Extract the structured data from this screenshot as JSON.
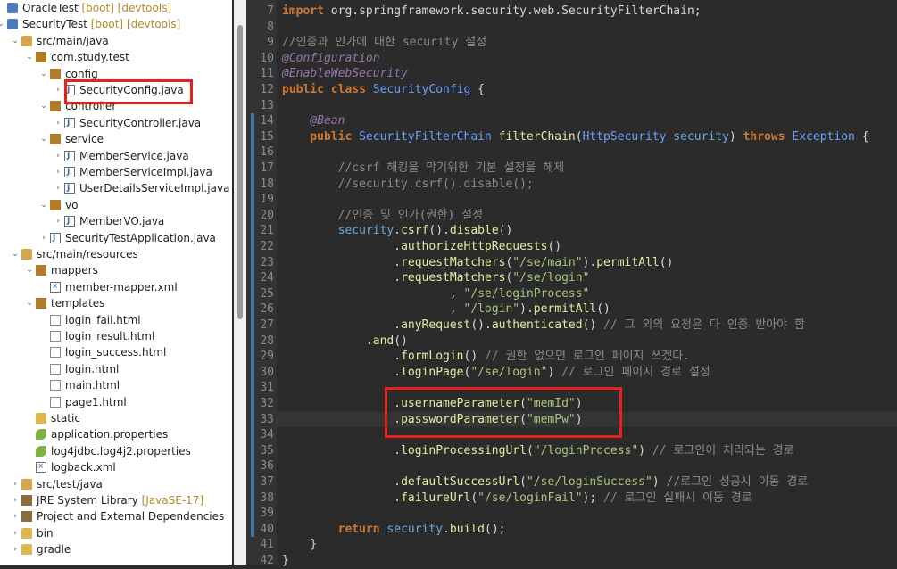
{
  "explorer": {
    "items": [
      {
        "label": "OracleTest",
        "dec": " [boot] [devtools]",
        "icon": "project-icon",
        "depth": 0,
        "arrow": ""
      },
      {
        "label": "SecurityTest",
        "dec": " [boot] [devtools]",
        "icon": "project-icon",
        "depth": 0,
        "arrow": "⌄"
      },
      {
        "label": "src/main/java",
        "dec": "",
        "icon": "source-folder-icon",
        "depth": 1,
        "arrow": "⌄"
      },
      {
        "label": "com.study.test",
        "dec": "",
        "icon": "package-icon",
        "depth": 2,
        "arrow": "⌄"
      },
      {
        "label": "config",
        "dec": "",
        "icon": "package-icon",
        "depth": 3,
        "arrow": "⌄"
      },
      {
        "label": "SecurityConfig.java",
        "dec": "",
        "icon": "java-file-icon",
        "depth": 4,
        "arrow": "›"
      },
      {
        "label": "controller",
        "dec": "",
        "icon": "package-icon",
        "depth": 3,
        "arrow": "⌄"
      },
      {
        "label": "SecurityController.java",
        "dec": "",
        "icon": "java-file-icon",
        "depth": 4,
        "arrow": "›"
      },
      {
        "label": "service",
        "dec": "",
        "icon": "package-icon",
        "depth": 3,
        "arrow": "⌄"
      },
      {
        "label": "MemberService.java",
        "dec": "",
        "icon": "java-file-icon",
        "depth": 4,
        "arrow": "›"
      },
      {
        "label": "MemberServiceImpl.java",
        "dec": "",
        "icon": "java-file-icon",
        "depth": 4,
        "arrow": "›"
      },
      {
        "label": "UserDetailsServiceImpl.java",
        "dec": "",
        "icon": "java-file-icon",
        "depth": 4,
        "arrow": "›"
      },
      {
        "label": "vo",
        "dec": "",
        "icon": "package-icon",
        "depth": 3,
        "arrow": "⌄"
      },
      {
        "label": "MemberVO.java",
        "dec": "",
        "icon": "java-file-icon",
        "depth": 4,
        "arrow": "›"
      },
      {
        "label": "SecurityTestApplication.java",
        "dec": "",
        "icon": "java-file-icon",
        "depth": 3,
        "arrow": "›"
      },
      {
        "label": "src/main/resources",
        "dec": "",
        "icon": "source-folder-icon",
        "depth": 1,
        "arrow": "⌄"
      },
      {
        "label": "mappers",
        "dec": "",
        "icon": "package-icon",
        "depth": 2,
        "arrow": "⌄"
      },
      {
        "label": "member-mapper.xml",
        "dec": "",
        "icon": "xml-file-icon",
        "depth": 3,
        "arrow": ""
      },
      {
        "label": "templates",
        "dec": "",
        "icon": "package-icon",
        "depth": 2,
        "arrow": "⌄"
      },
      {
        "label": "login_fail.html",
        "dec": "",
        "icon": "html-file-icon",
        "depth": 3,
        "arrow": ""
      },
      {
        "label": "login_result.html",
        "dec": "",
        "icon": "html-file-icon",
        "depth": 3,
        "arrow": ""
      },
      {
        "label": "login_success.html",
        "dec": "",
        "icon": "html-file-icon",
        "depth": 3,
        "arrow": ""
      },
      {
        "label": "login.html",
        "dec": "",
        "icon": "html-file-icon",
        "depth": 3,
        "arrow": ""
      },
      {
        "label": "main.html",
        "dec": "",
        "icon": "html-file-icon",
        "depth": 3,
        "arrow": ""
      },
      {
        "label": "page1.html",
        "dec": "",
        "icon": "html-file-icon",
        "depth": 3,
        "arrow": ""
      },
      {
        "label": "static",
        "dec": "",
        "icon": "folder-icon",
        "depth": 2,
        "arrow": ""
      },
      {
        "label": "application.properties",
        "dec": "",
        "icon": "properties-file-icon",
        "depth": 2,
        "arrow": ""
      },
      {
        "label": "log4jdbc.log4j2.properties",
        "dec": "",
        "icon": "properties-file-icon",
        "depth": 2,
        "arrow": ""
      },
      {
        "label": "logback.xml",
        "dec": "",
        "icon": "xml-file-icon",
        "depth": 2,
        "arrow": ""
      },
      {
        "label": "src/test/java",
        "dec": "",
        "icon": "source-folder-icon",
        "depth": 1,
        "arrow": "›"
      },
      {
        "label": "JRE System Library",
        "dec": " [JavaSE-17]",
        "icon": "library-icon",
        "depth": 1,
        "arrow": "›"
      },
      {
        "label": "Project and External Dependencies",
        "dec": "",
        "icon": "library-icon",
        "depth": 1,
        "arrow": "›"
      },
      {
        "label": "bin",
        "dec": "",
        "icon": "folder-icon",
        "depth": 1,
        "arrow": "›"
      },
      {
        "label": "gradle",
        "dec": "",
        "icon": "folder-icon",
        "depth": 1,
        "arrow": "›"
      }
    ]
  },
  "editor": {
    "lines": [
      {
        "n": "7",
        "parts": [
          [
            "kw",
            "import "
          ],
          [
            "pl",
            "org.springframework.security.web.SecurityFilterChain;"
          ]
        ]
      },
      {
        "n": "8",
        "parts": []
      },
      {
        "n": "9",
        "parts": [
          [
            "cm",
            "//인증과 인가에 대한 security 설정"
          ]
        ]
      },
      {
        "n": "10",
        "parts": [
          [
            "an",
            "@Configuration"
          ]
        ]
      },
      {
        "n": "11",
        "parts": [
          [
            "an",
            "@EnableWebSecurity"
          ]
        ]
      },
      {
        "n": "12",
        "parts": [
          [
            "kw",
            "public class "
          ],
          [
            "ty",
            "SecurityConfig"
          ],
          [
            "pl",
            " {"
          ]
        ]
      },
      {
        "n": "13",
        "parts": []
      },
      {
        "n": "14",
        "parts": [
          [
            "pl",
            "    "
          ],
          [
            "an",
            "@Bean"
          ]
        ]
      },
      {
        "n": "15",
        "parts": [
          [
            "pl",
            "    "
          ],
          [
            "kw",
            "public "
          ],
          [
            "ty",
            "SecurityFilterChain "
          ],
          [
            "mt",
            "filterChain"
          ],
          [
            "pl",
            "("
          ],
          [
            "ty",
            "HttpSecurity "
          ],
          [
            "var",
            "security"
          ],
          [
            "pl",
            ") "
          ],
          [
            "kw",
            "throws "
          ],
          [
            "ty",
            "Exception"
          ],
          [
            "pl",
            " {"
          ]
        ]
      },
      {
        "n": "16",
        "parts": []
      },
      {
        "n": "17",
        "parts": [
          [
            "cm",
            "        //csrf 해킹을 막기위한 기본 설정을 해제"
          ]
        ]
      },
      {
        "n": "18",
        "parts": [
          [
            "cm",
            "        //security.csrf().disable();"
          ]
        ]
      },
      {
        "n": "19",
        "parts": []
      },
      {
        "n": "20",
        "parts": [
          [
            "cm",
            "        //인증 및 인가(권한) 설정"
          ]
        ]
      },
      {
        "n": "21",
        "parts": [
          [
            "pl",
            "        "
          ],
          [
            "var",
            "security"
          ],
          [
            "pl",
            "."
          ],
          [
            "mt",
            "csrf"
          ],
          [
            "pl",
            "()."
          ],
          [
            "mt",
            "disable"
          ],
          [
            "pl",
            "()"
          ]
        ]
      },
      {
        "n": "22",
        "parts": [
          [
            "pl",
            "                ."
          ],
          [
            "mt",
            "authorizeHttpRequests"
          ],
          [
            "pl",
            "()"
          ]
        ]
      },
      {
        "n": "23",
        "parts": [
          [
            "pl",
            "                ."
          ],
          [
            "mt",
            "requestMatchers"
          ],
          [
            "pl",
            "("
          ],
          [
            "st",
            "\"/se/main\""
          ],
          [
            "pl",
            ")."
          ],
          [
            "mt",
            "permitAll"
          ],
          [
            "pl",
            "()"
          ]
        ]
      },
      {
        "n": "24",
        "parts": [
          [
            "pl",
            "                ."
          ],
          [
            "mt",
            "requestMatchers"
          ],
          [
            "pl",
            "("
          ],
          [
            "st",
            "\"/se/login\""
          ]
        ]
      },
      {
        "n": "25",
        "parts": [
          [
            "pl",
            "                        , "
          ],
          [
            "st",
            "\"/se/loginProcess\""
          ]
        ]
      },
      {
        "n": "26",
        "parts": [
          [
            "pl",
            "                        , "
          ],
          [
            "st",
            "\"/login\""
          ],
          [
            "pl",
            ")."
          ],
          [
            "mt",
            "permitAll"
          ],
          [
            "pl",
            "()"
          ]
        ]
      },
      {
        "n": "27",
        "parts": [
          [
            "pl",
            "                ."
          ],
          [
            "mt",
            "anyRequest"
          ],
          [
            "pl",
            "()."
          ],
          [
            "mt",
            "authenticated"
          ],
          [
            "pl",
            "() "
          ],
          [
            "cm",
            "// 그 외의 요청은 다 인증 받아야 함"
          ]
        ]
      },
      {
        "n": "28",
        "parts": [
          [
            "pl",
            "            ."
          ],
          [
            "mt",
            "and"
          ],
          [
            "pl",
            "()"
          ]
        ]
      },
      {
        "n": "29",
        "parts": [
          [
            "pl",
            "                ."
          ],
          [
            "mt",
            "formLogin"
          ],
          [
            "pl",
            "() "
          ],
          [
            "cm",
            "// 권한 없으면 로그인 페이지 쓰겠다."
          ]
        ]
      },
      {
        "n": "30",
        "parts": [
          [
            "pl",
            "                ."
          ],
          [
            "mt",
            "loginPage"
          ],
          [
            "pl",
            "("
          ],
          [
            "st",
            "\"/se/login\""
          ],
          [
            "pl",
            ") "
          ],
          [
            "cm",
            "// 로그인 페이지 경로 설정"
          ]
        ]
      },
      {
        "n": "31",
        "parts": []
      },
      {
        "n": "32",
        "parts": [
          [
            "pl",
            "                ."
          ],
          [
            "mt",
            "usernameParameter"
          ],
          [
            "pl",
            "("
          ],
          [
            "st",
            "\"memId\""
          ],
          [
            "pl",
            ")"
          ]
        ]
      },
      {
        "n": "33",
        "parts": [
          [
            "pl",
            "                ."
          ],
          [
            "mt",
            "passwordParameter"
          ],
          [
            "pl",
            "("
          ],
          [
            "st",
            "\"memPw\""
          ],
          [
            "pl",
            ")"
          ]
        ]
      },
      {
        "n": "34",
        "parts": []
      },
      {
        "n": "35",
        "parts": [
          [
            "pl",
            "                ."
          ],
          [
            "mt",
            "loginProcessingUrl"
          ],
          [
            "pl",
            "("
          ],
          [
            "st",
            "\"/loginProcess\""
          ],
          [
            "pl",
            ") "
          ],
          [
            "cm",
            "// 로그인이 처리되는 경로"
          ]
        ]
      },
      {
        "n": "36",
        "parts": []
      },
      {
        "n": "37",
        "parts": [
          [
            "pl",
            "                ."
          ],
          [
            "mt",
            "defaultSuccessUrl"
          ],
          [
            "pl",
            "("
          ],
          [
            "st",
            "\"/se/loginSuccess\""
          ],
          [
            "pl",
            ") "
          ],
          [
            "cm",
            "//로그인 성공시 이동 경로"
          ]
        ]
      },
      {
        "n": "38",
        "parts": [
          [
            "pl",
            "                ."
          ],
          [
            "mt",
            "failureUrl"
          ],
          [
            "pl",
            "("
          ],
          [
            "st",
            "\"/se/loginFail\""
          ],
          [
            "pl",
            "); "
          ],
          [
            "cm",
            "// 로그인 실패시 이동 경로"
          ]
        ]
      },
      {
        "n": "39",
        "parts": []
      },
      {
        "n": "40",
        "parts": [
          [
            "pl",
            "        "
          ],
          [
            "kw",
            "return "
          ],
          [
            "var",
            "security"
          ],
          [
            "pl",
            "."
          ],
          [
            "mt",
            "build"
          ],
          [
            "pl",
            "();"
          ]
        ]
      },
      {
        "n": "41",
        "parts": [
          [
            "pl",
            "    }"
          ]
        ]
      },
      {
        "n": "42",
        "parts": [
          [
            "pl",
            "}"
          ]
        ]
      }
    ]
  },
  "colors": {
    "highlight": "#e8201c",
    "editor_bg": "#2b2b2b"
  }
}
